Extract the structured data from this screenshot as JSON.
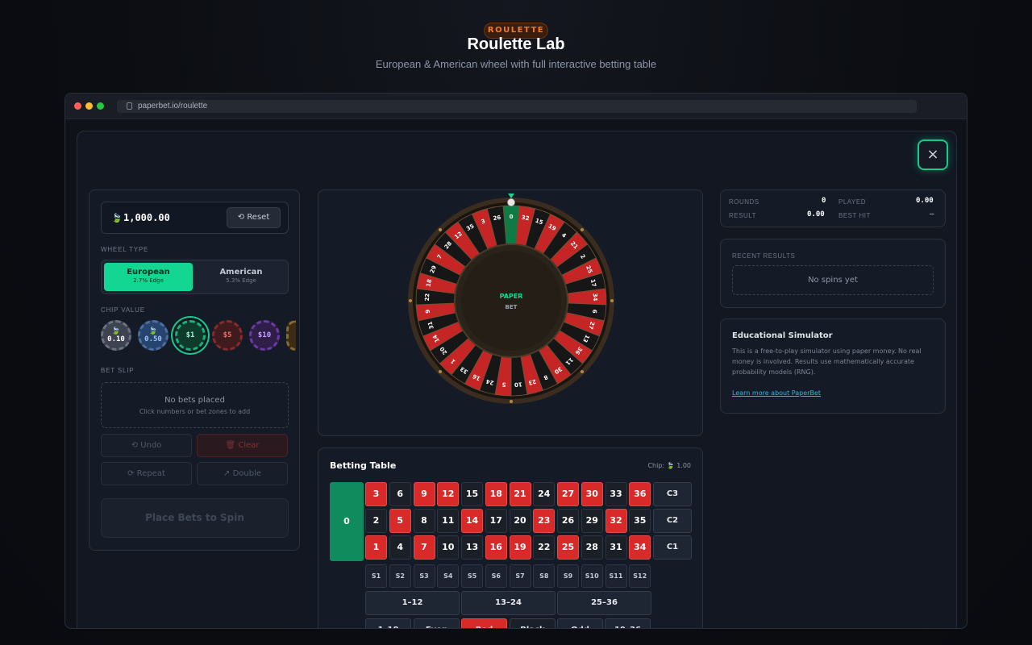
{
  "header": {
    "badge": "ROULETTE",
    "title": "Roulette Lab",
    "subtitle": "European & American wheel with full interactive betting table"
  },
  "browser": {
    "url": "paperbet.io/roulette"
  },
  "modal": {
    "close_icon": "×"
  },
  "sidebar": {
    "balance_icon": "🍃",
    "balance": "1,000.00",
    "reset_label": "Reset",
    "wheel_type_label": "WHEEL TYPE",
    "wheel_types": [
      {
        "name": "European",
        "edge": "2.7% Edge",
        "selected": true
      },
      {
        "name": "American",
        "edge": "5.3% Edge",
        "selected": false
      }
    ],
    "chip_value_label": "CHIP VALUE",
    "chips": [
      {
        "label": "0.10",
        "color": "#5a6272"
      },
      {
        "label": "0.50",
        "color": "#3b5b8a"
      },
      {
        "label": "$1",
        "color": "#17b37a",
        "selected": true
      },
      {
        "label": "$5",
        "color": "#9c2a2a"
      },
      {
        "label": "$10",
        "color": "#6c3aa8"
      }
    ],
    "bet_slip_label": "BET SLIP",
    "no_bets": "No bets placed",
    "no_bets_hint": "Click numbers or bet zones to add",
    "undo_label": "Undo",
    "clear_label": "Clear",
    "repeat_label": "Repeat",
    "double_label": "Double",
    "spin_label": "Place Bets to Spin"
  },
  "wheel": {
    "center_top": "PAPER",
    "center_bottom": "BET",
    "pockets": [
      "0",
      "32",
      "15",
      "19",
      "4",
      "21",
      "2",
      "25",
      "17",
      "34",
      "6",
      "27",
      "13",
      "36",
      "11",
      "30",
      "8",
      "23",
      "10",
      "5",
      "24",
      "16",
      "33",
      "1",
      "20",
      "14",
      "31",
      "9",
      "22",
      "18",
      "29",
      "7",
      "28",
      "12",
      "35",
      "3",
      "26"
    ],
    "red_numbers": [
      1,
      3,
      5,
      7,
      9,
      12,
      14,
      16,
      18,
      19,
      21,
      23,
      25,
      27,
      30,
      32,
      34,
      36
    ]
  },
  "table": {
    "title": "Betting Table",
    "chip_label": "Chip:",
    "chip_icon": "🍃",
    "chip_value": "1.00",
    "zero": "0",
    "columns": [
      "C3",
      "C2",
      "C1"
    ],
    "splits": [
      "S1",
      "S2",
      "S3",
      "S4",
      "S5",
      "S6",
      "S7",
      "S8",
      "S9",
      "S10",
      "S11",
      "S12"
    ],
    "dozens": [
      "1–12",
      "13–24",
      "25–36"
    ],
    "outside": [
      "1–18",
      "Even",
      "Red",
      "Black",
      "Odd",
      "19–36"
    ]
  },
  "stats": {
    "rounds_label": "ROUNDS",
    "rounds": "0",
    "played_label": "PLAYED",
    "played": "0.00",
    "result_label": "RESULT",
    "result": "0.00",
    "best_hit_label": "BEST HIT",
    "best_hit": "–"
  },
  "recent": {
    "label": "RECENT RESULTS",
    "empty": "No spins yet"
  },
  "edu": {
    "title": "Educational Simulator",
    "body": "This is a free-to-play simulator using paper money. No real money is involved. Results use mathematically accurate probability models (RNG).",
    "link": "Learn more about PaperBet"
  }
}
